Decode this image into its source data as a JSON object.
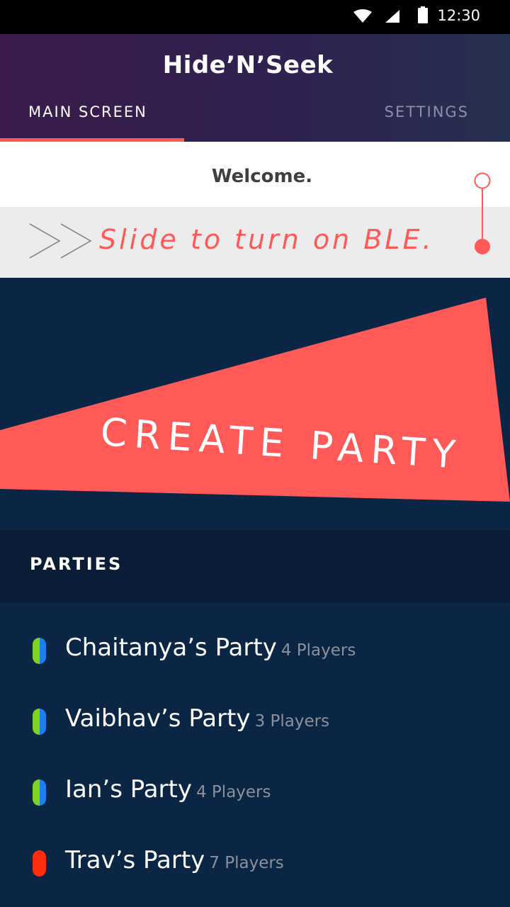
{
  "status_bar": {
    "time": "12:30",
    "icons": [
      "wifi-icon",
      "signal-icon",
      "battery-icon"
    ]
  },
  "app": {
    "title": "Hide’N’Seek"
  },
  "tabs": [
    {
      "label": "MAIN SCREEN",
      "active": true
    },
    {
      "label": "SETTINGS",
      "active": false
    }
  ],
  "welcome": {
    "text": "Welcome."
  },
  "slider": {
    "text": "Slide to turn on BLE.",
    "icon": "chevron-right-icon"
  },
  "create_party": {
    "label": "CREATE PARTY"
  },
  "parties": {
    "title": "PARTIES",
    "items": [
      {
        "name": "Chaitanya’s Party",
        "players": "4 Players",
        "status_colors": [
          "#7ed321",
          "#1f7ff0"
        ]
      },
      {
        "name": "Vaibhav’s Party",
        "players": "3 Players",
        "status_colors": [
          "#7ed321",
          "#1f7ff0"
        ]
      },
      {
        "name": "Ian’s Party",
        "players": "4 Players",
        "status_colors": [
          "#7ed321",
          "#1f7ff0"
        ]
      },
      {
        "name": "Trav’s Party",
        "players": "7 Players",
        "status_colors": [
          "#ff2d10",
          "#ff2d10"
        ]
      }
    ]
  },
  "colors": {
    "accent": "#ff5a57",
    "background": "#0b2545",
    "header_dark": "#0b1c36"
  }
}
